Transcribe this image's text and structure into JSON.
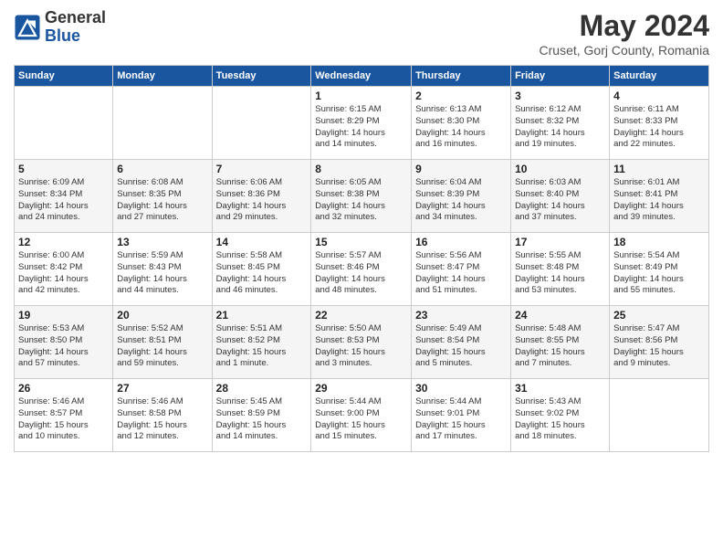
{
  "header": {
    "logo_general": "General",
    "logo_blue": "Blue",
    "month_title": "May 2024",
    "location": "Cruset, Gorj County, Romania"
  },
  "weekdays": [
    "Sunday",
    "Monday",
    "Tuesday",
    "Wednesday",
    "Thursday",
    "Friday",
    "Saturday"
  ],
  "weeks": [
    [
      {
        "day": "",
        "info": ""
      },
      {
        "day": "",
        "info": ""
      },
      {
        "day": "",
        "info": ""
      },
      {
        "day": "1",
        "info": "Sunrise: 6:15 AM\nSunset: 8:29 PM\nDaylight: 14 hours\nand 14 minutes."
      },
      {
        "day": "2",
        "info": "Sunrise: 6:13 AM\nSunset: 8:30 PM\nDaylight: 14 hours\nand 16 minutes."
      },
      {
        "day": "3",
        "info": "Sunrise: 6:12 AM\nSunset: 8:32 PM\nDaylight: 14 hours\nand 19 minutes."
      },
      {
        "day": "4",
        "info": "Sunrise: 6:11 AM\nSunset: 8:33 PM\nDaylight: 14 hours\nand 22 minutes."
      }
    ],
    [
      {
        "day": "5",
        "info": "Sunrise: 6:09 AM\nSunset: 8:34 PM\nDaylight: 14 hours\nand 24 minutes."
      },
      {
        "day": "6",
        "info": "Sunrise: 6:08 AM\nSunset: 8:35 PM\nDaylight: 14 hours\nand 27 minutes."
      },
      {
        "day": "7",
        "info": "Sunrise: 6:06 AM\nSunset: 8:36 PM\nDaylight: 14 hours\nand 29 minutes."
      },
      {
        "day": "8",
        "info": "Sunrise: 6:05 AM\nSunset: 8:38 PM\nDaylight: 14 hours\nand 32 minutes."
      },
      {
        "day": "9",
        "info": "Sunrise: 6:04 AM\nSunset: 8:39 PM\nDaylight: 14 hours\nand 34 minutes."
      },
      {
        "day": "10",
        "info": "Sunrise: 6:03 AM\nSunset: 8:40 PM\nDaylight: 14 hours\nand 37 minutes."
      },
      {
        "day": "11",
        "info": "Sunrise: 6:01 AM\nSunset: 8:41 PM\nDaylight: 14 hours\nand 39 minutes."
      }
    ],
    [
      {
        "day": "12",
        "info": "Sunrise: 6:00 AM\nSunset: 8:42 PM\nDaylight: 14 hours\nand 42 minutes."
      },
      {
        "day": "13",
        "info": "Sunrise: 5:59 AM\nSunset: 8:43 PM\nDaylight: 14 hours\nand 44 minutes."
      },
      {
        "day": "14",
        "info": "Sunrise: 5:58 AM\nSunset: 8:45 PM\nDaylight: 14 hours\nand 46 minutes."
      },
      {
        "day": "15",
        "info": "Sunrise: 5:57 AM\nSunset: 8:46 PM\nDaylight: 14 hours\nand 48 minutes."
      },
      {
        "day": "16",
        "info": "Sunrise: 5:56 AM\nSunset: 8:47 PM\nDaylight: 14 hours\nand 51 minutes."
      },
      {
        "day": "17",
        "info": "Sunrise: 5:55 AM\nSunset: 8:48 PM\nDaylight: 14 hours\nand 53 minutes."
      },
      {
        "day": "18",
        "info": "Sunrise: 5:54 AM\nSunset: 8:49 PM\nDaylight: 14 hours\nand 55 minutes."
      }
    ],
    [
      {
        "day": "19",
        "info": "Sunrise: 5:53 AM\nSunset: 8:50 PM\nDaylight: 14 hours\nand 57 minutes."
      },
      {
        "day": "20",
        "info": "Sunrise: 5:52 AM\nSunset: 8:51 PM\nDaylight: 14 hours\nand 59 minutes."
      },
      {
        "day": "21",
        "info": "Sunrise: 5:51 AM\nSunset: 8:52 PM\nDaylight: 15 hours\nand 1 minute."
      },
      {
        "day": "22",
        "info": "Sunrise: 5:50 AM\nSunset: 8:53 PM\nDaylight: 15 hours\nand 3 minutes."
      },
      {
        "day": "23",
        "info": "Sunrise: 5:49 AM\nSunset: 8:54 PM\nDaylight: 15 hours\nand 5 minutes."
      },
      {
        "day": "24",
        "info": "Sunrise: 5:48 AM\nSunset: 8:55 PM\nDaylight: 15 hours\nand 7 minutes."
      },
      {
        "day": "25",
        "info": "Sunrise: 5:47 AM\nSunset: 8:56 PM\nDaylight: 15 hours\nand 9 minutes."
      }
    ],
    [
      {
        "day": "26",
        "info": "Sunrise: 5:46 AM\nSunset: 8:57 PM\nDaylight: 15 hours\nand 10 minutes."
      },
      {
        "day": "27",
        "info": "Sunrise: 5:46 AM\nSunset: 8:58 PM\nDaylight: 15 hours\nand 12 minutes."
      },
      {
        "day": "28",
        "info": "Sunrise: 5:45 AM\nSunset: 8:59 PM\nDaylight: 15 hours\nand 14 minutes."
      },
      {
        "day": "29",
        "info": "Sunrise: 5:44 AM\nSunset: 9:00 PM\nDaylight: 15 hours\nand 15 minutes."
      },
      {
        "day": "30",
        "info": "Sunrise: 5:44 AM\nSunset: 9:01 PM\nDaylight: 15 hours\nand 17 minutes."
      },
      {
        "day": "31",
        "info": "Sunrise: 5:43 AM\nSunset: 9:02 PM\nDaylight: 15 hours\nand 18 minutes."
      },
      {
        "day": "",
        "info": ""
      }
    ]
  ]
}
